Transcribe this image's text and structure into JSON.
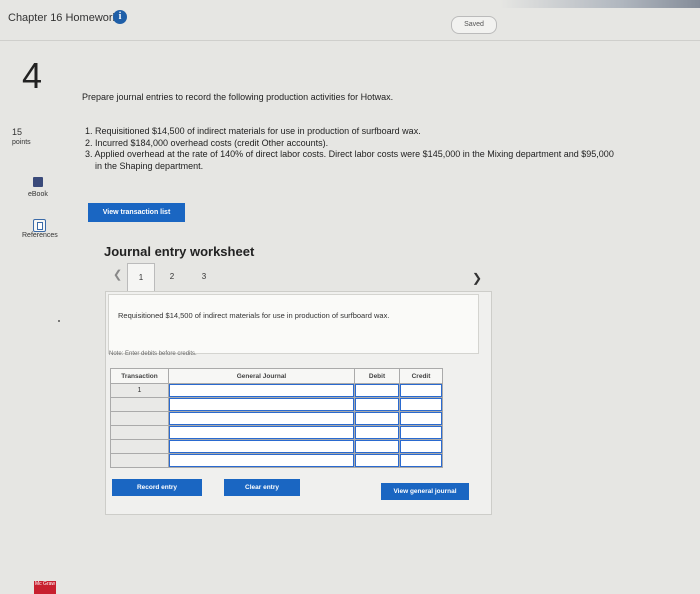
{
  "header": {
    "title": "Chapter 16 Homework",
    "info_icon": "info-icon",
    "saved_label": "Saved"
  },
  "question": {
    "number": "4",
    "points_value": "15",
    "points_label": "points"
  },
  "sidebar": {
    "ebook_label": "eBook",
    "references_label": "References"
  },
  "prompt": "Prepare journal entries to record the following production activities for Hotwax.",
  "items": [
    "1. Requisitioned $14,500 of indirect materials for use in production of surfboard wax.",
    "2. Incurred $184,000 overhead costs (credit Other accounts).",
    "3. Applied overhead at the rate of 140% of direct labor costs. Direct labor costs were $145,000 in the Mixing department and $95,000",
    "in the Shaping department."
  ],
  "view_transaction_list_label": "View transaction list",
  "worksheet": {
    "title": "Journal entry worksheet",
    "prev_icon": "chevron-left-icon",
    "next_icon": "chevron-right-icon",
    "tabs": [
      "1",
      "2",
      "3"
    ],
    "active_tab": "1",
    "description": "Requisitioned $14,500 of indirect materials for use in production of surfboard wax.",
    "note": "Note: Enter debits before credits.",
    "table": {
      "headers": [
        "Transaction",
        "General Journal",
        "Debit",
        "Credit"
      ],
      "first_transaction": "1"
    },
    "record_entry_label": "Record entry",
    "clear_entry_label": "Clear entry",
    "view_general_journal_label": "View general journal"
  },
  "footer": {
    "logo_text": "Mc Graw"
  }
}
